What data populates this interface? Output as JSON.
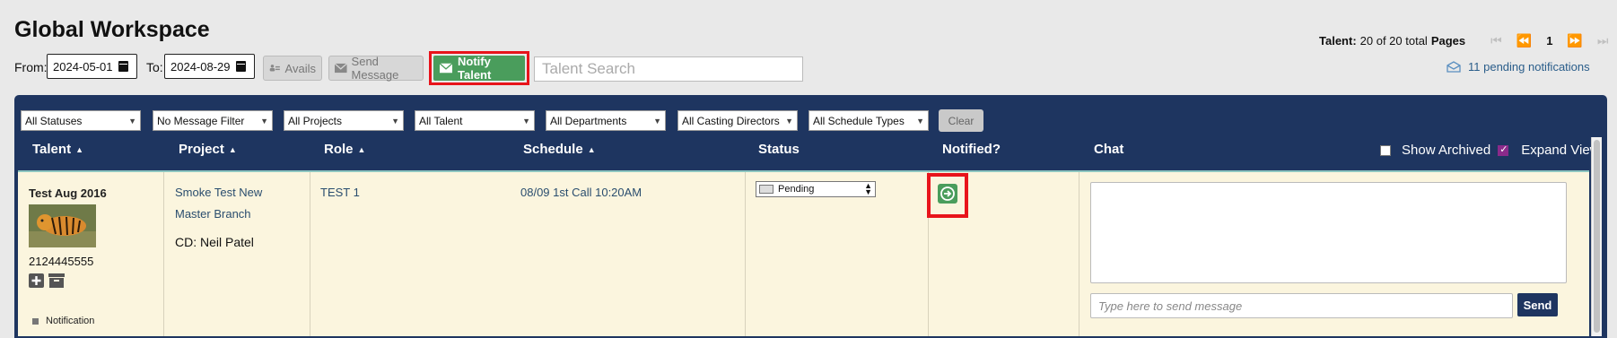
{
  "header": {
    "title": "Global Workspace",
    "from_label": "From:",
    "from_value": "2024-05-01",
    "to_label": "To:",
    "to_value": "2024-08-29",
    "avails_label": "Avails",
    "send_message_label": "Send Message",
    "notify_talent_label": "Notify Talent",
    "talent_search_placeholder": "Talent Search"
  },
  "pager": {
    "talent_label": "Talent:",
    "count_text": "20 of 20 total",
    "pages_label": "Pages",
    "current_page": "1",
    "notifications_text": "11 pending notifications"
  },
  "filters": {
    "statuses": "All Statuses",
    "message": "No Message Filter",
    "projects": "All Projects",
    "talent": "All Talent",
    "departments": "All Departments",
    "casting_directors": "All Casting Directors",
    "schedule_types": "All Schedule Types",
    "clear_label": "Clear"
  },
  "table": {
    "headers": {
      "talent": "Talent",
      "project": "Project",
      "role": "Role",
      "schedule": "Schedule",
      "status": "Status",
      "notified": "Notified?",
      "chat": "Chat"
    },
    "show_archived_label": "Show Archived",
    "expand_view_label": "Expand View",
    "show_archived_checked": false,
    "expand_view_checked": true,
    "row": {
      "talent_name": "Test Aug 2016",
      "phone": "2124445555",
      "notification_label": "Notification",
      "project_line1": "Smoke Test New",
      "project_line2": "Master Branch",
      "cd_text": "CD: Neil Patel",
      "role": "TEST 1",
      "schedule": "08/09 1st Call 10:20AM",
      "status": "Pending",
      "chat_placeholder": "Type here to send message",
      "send_label": "Send"
    }
  },
  "colors": {
    "panel": "#1e3560",
    "notify_green": "#4a9d5c",
    "highlight_red": "#e8141b",
    "row_bg": "#fbf5de"
  }
}
